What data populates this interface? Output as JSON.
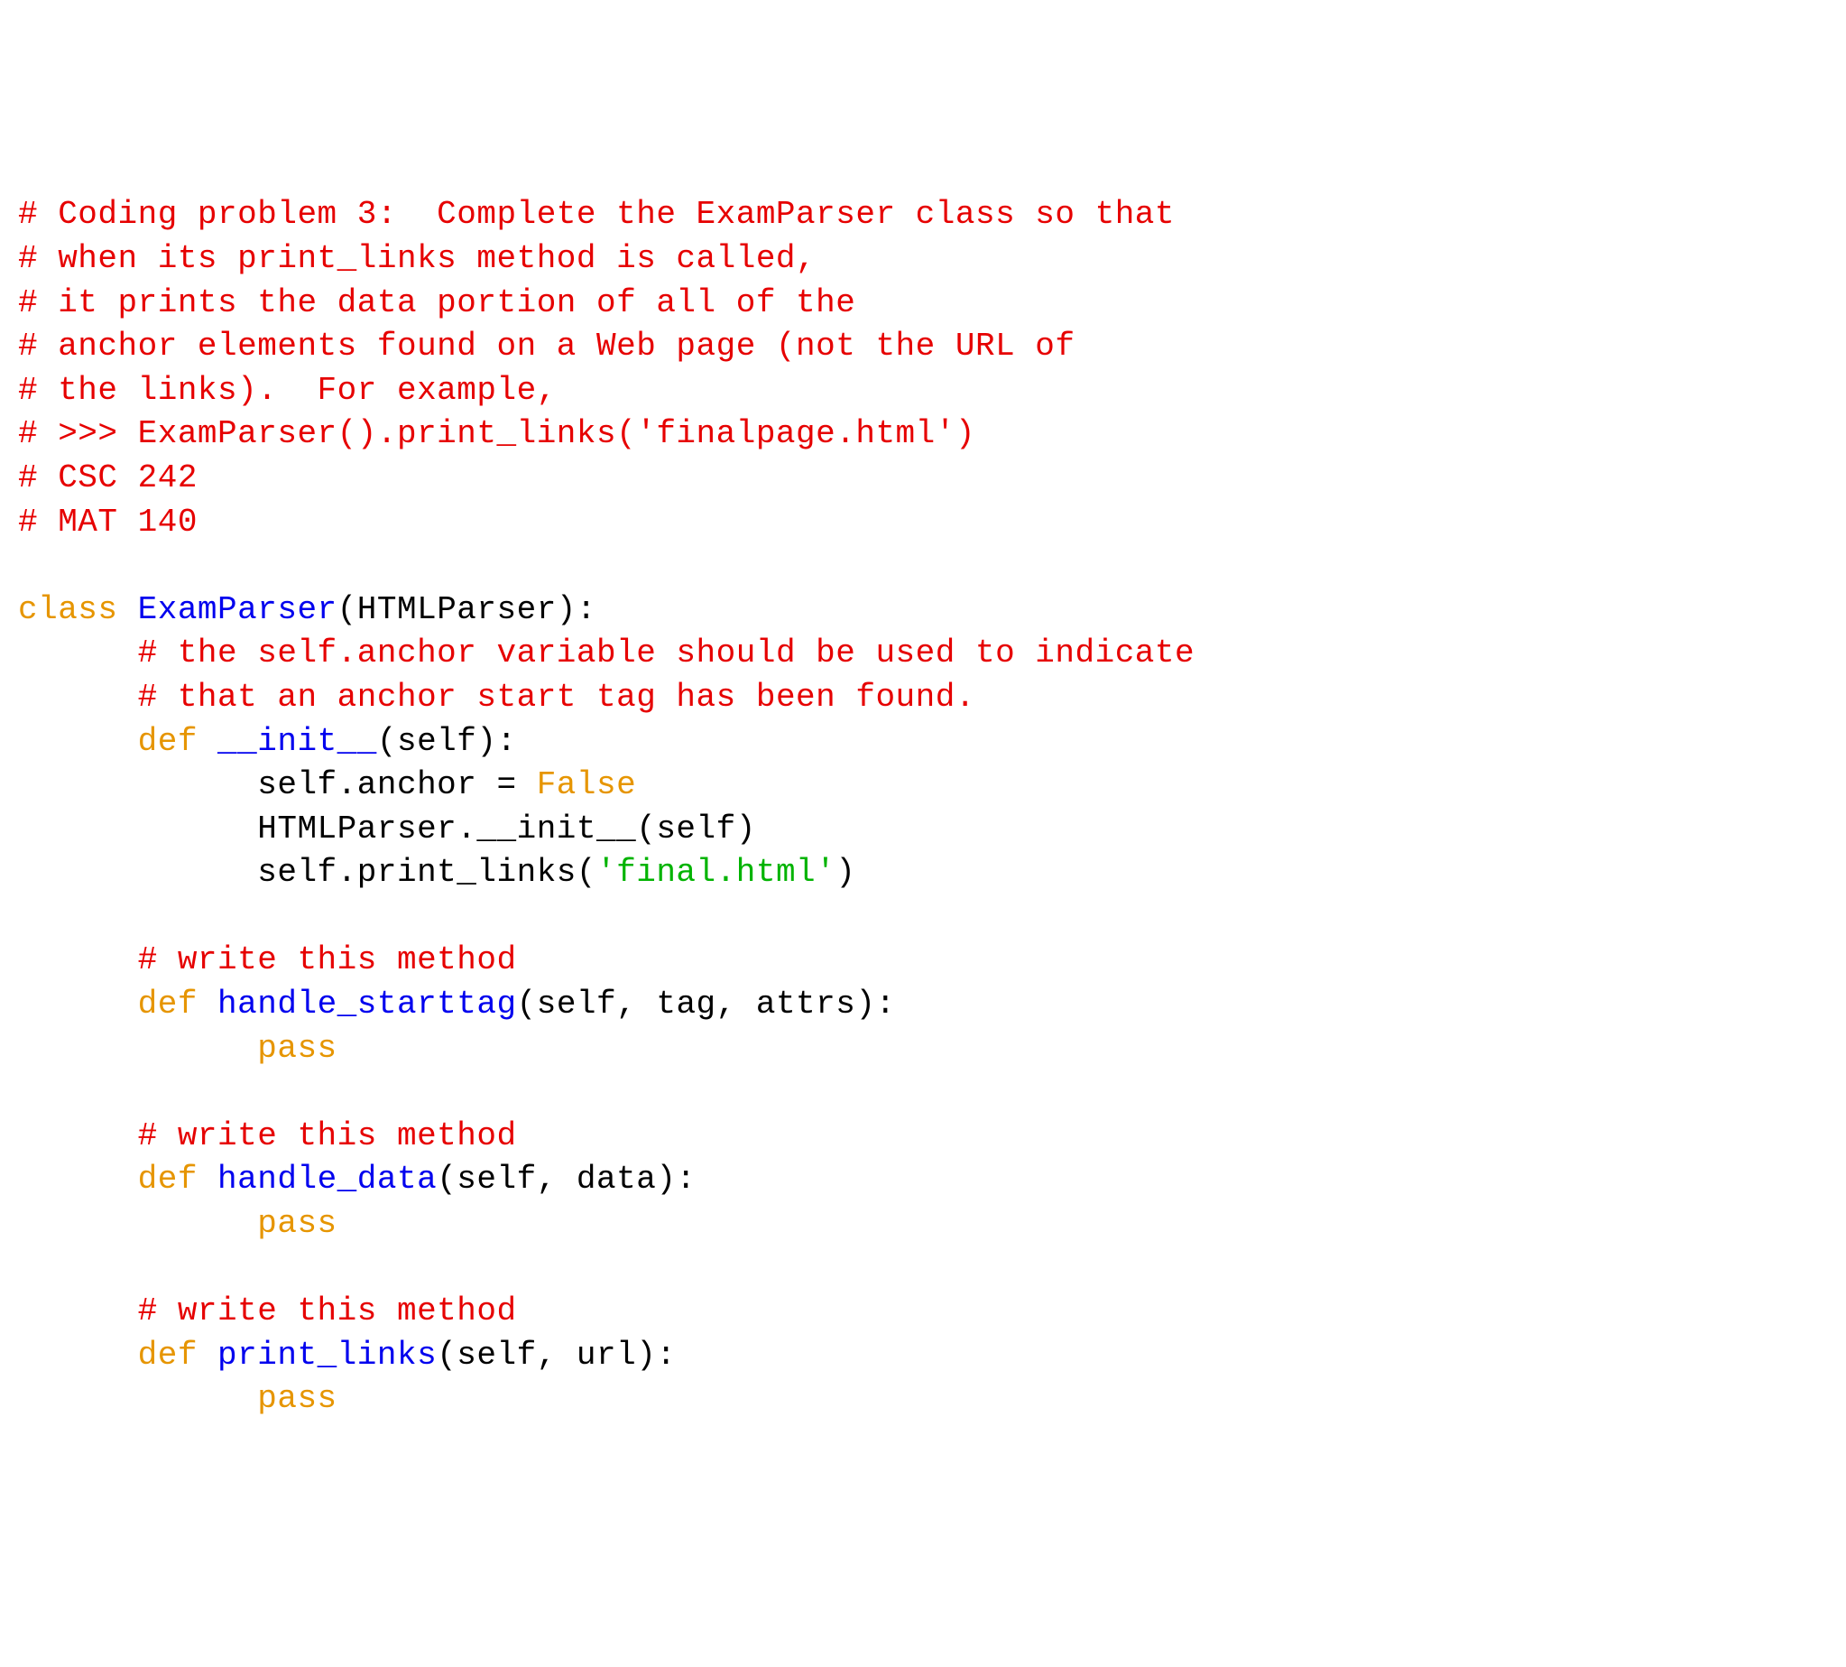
{
  "code": {
    "lines": [
      [
        {
          "cls": "t-comment",
          "text": "# Coding problem 3:  Complete the ExamParser class so that"
        }
      ],
      [
        {
          "cls": "t-comment",
          "text": "# when its print_links method is called,"
        }
      ],
      [
        {
          "cls": "t-comment",
          "text": "# it prints the data portion of all of the"
        }
      ],
      [
        {
          "cls": "t-comment",
          "text": "# anchor elements found on a Web page (not the URL of"
        }
      ],
      [
        {
          "cls": "t-comment",
          "text": "# the links).  For example,"
        }
      ],
      [
        {
          "cls": "t-comment",
          "text": "# >>> ExamParser().print_links('finalpage.html')"
        }
      ],
      [
        {
          "cls": "t-comment",
          "text": "# CSC 242"
        }
      ],
      [
        {
          "cls": "t-comment",
          "text": "# MAT 140"
        }
      ],
      [
        {
          "cls": "t-black",
          "text": ""
        }
      ],
      [
        {
          "cls": "t-keyword-class",
          "text": "class "
        },
        {
          "cls": "t-name-blue",
          "text": "ExamParser"
        },
        {
          "cls": "t-black",
          "text": "(HTMLParser):"
        }
      ],
      [
        {
          "cls": "t-black",
          "text": "      "
        },
        {
          "cls": "t-comment",
          "text": "# the self.anchor variable should be used to indicate"
        }
      ],
      [
        {
          "cls": "t-black",
          "text": "      "
        },
        {
          "cls": "t-comment",
          "text": "# that an anchor start tag has been found."
        }
      ],
      [
        {
          "cls": "t-black",
          "text": "      "
        },
        {
          "cls": "t-keyword-def",
          "text": "def "
        },
        {
          "cls": "t-name-blue",
          "text": "__init__"
        },
        {
          "cls": "t-black",
          "text": "(self):"
        }
      ],
      [
        {
          "cls": "t-black",
          "text": "            self.anchor = "
        },
        {
          "cls": "t-false",
          "text": "False"
        }
      ],
      [
        {
          "cls": "t-black",
          "text": "            HTMLParser.__init__(self)"
        }
      ],
      [
        {
          "cls": "t-black",
          "text": "            self.print_links("
        },
        {
          "cls": "t-string",
          "text": "'final.html'"
        },
        {
          "cls": "t-black",
          "text": ")"
        }
      ],
      [
        {
          "cls": "t-black",
          "text": ""
        }
      ],
      [
        {
          "cls": "t-black",
          "text": "      "
        },
        {
          "cls": "t-comment",
          "text": "# write this method"
        }
      ],
      [
        {
          "cls": "t-black",
          "text": "      "
        },
        {
          "cls": "t-keyword-def",
          "text": "def "
        },
        {
          "cls": "t-name-blue",
          "text": "handle_starttag"
        },
        {
          "cls": "t-black",
          "text": "(self, tag, attrs):"
        }
      ],
      [
        {
          "cls": "t-black",
          "text": "            "
        },
        {
          "cls": "t-keyword-pass",
          "text": "pass"
        }
      ],
      [
        {
          "cls": "t-black",
          "text": ""
        }
      ],
      [
        {
          "cls": "t-black",
          "text": "      "
        },
        {
          "cls": "t-comment",
          "text": "# write this method"
        }
      ],
      [
        {
          "cls": "t-black",
          "text": "      "
        },
        {
          "cls": "t-keyword-def",
          "text": "def "
        },
        {
          "cls": "t-name-blue",
          "text": "handle_data"
        },
        {
          "cls": "t-black",
          "text": "(self, data):"
        }
      ],
      [
        {
          "cls": "t-black",
          "text": "            "
        },
        {
          "cls": "t-keyword-pass",
          "text": "pass"
        }
      ],
      [
        {
          "cls": "t-black",
          "text": ""
        }
      ],
      [
        {
          "cls": "t-black",
          "text": "      "
        },
        {
          "cls": "t-comment",
          "text": "# write this method"
        }
      ],
      [
        {
          "cls": "t-black",
          "text": "      "
        },
        {
          "cls": "t-keyword-def",
          "text": "def "
        },
        {
          "cls": "t-name-blue",
          "text": "print_links"
        },
        {
          "cls": "t-black",
          "text": "(self, url):"
        }
      ],
      [
        {
          "cls": "t-black",
          "text": "            "
        },
        {
          "cls": "t-keyword-pass",
          "text": "pass"
        }
      ]
    ]
  }
}
